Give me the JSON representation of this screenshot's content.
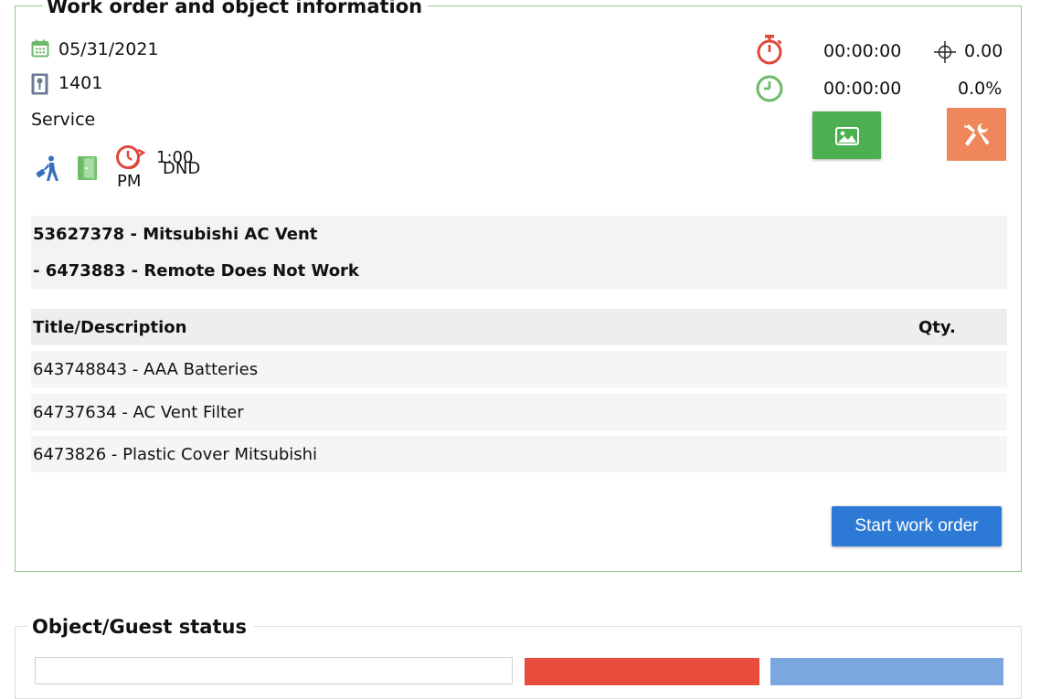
{
  "work_order": {
    "legend": "Work order and object information",
    "date": "05/31/2021",
    "room": "1401",
    "type": "Service",
    "dnd_time_line1": "1:00",
    "dnd_time_line2": "PM",
    "dnd_label": "DND",
    "timer_elapsed": "00:00:00",
    "timer_clock": "00:00:00",
    "distance": "0.00",
    "percent": "0.0%",
    "issue_line1": "53627378 - Mitsubishi AC Vent",
    "issue_line2": "- 6473883 - Remote Does Not Work",
    "table": {
      "headers": [
        "Title/Description",
        "Qty."
      ],
      "rows": [
        {
          "title": "643748843 - AAA Batteries",
          "qty": ""
        },
        {
          "title": "64737634 - AC Vent Filter",
          "qty": ""
        },
        {
          "title": "6473826 - Plastic Cover Mitsubishi",
          "qty": ""
        }
      ]
    },
    "start_button": "Start work order"
  },
  "object_status": {
    "legend": "Object/Guest status"
  },
  "colors": {
    "border_green": "#8cc985",
    "green_button": "#4caf50",
    "orange_button": "#f0875a",
    "blue_button": "#2d7ad6",
    "red_button": "#e74c3c",
    "light_blue_button": "#7aa7e0",
    "timer_red": "#e0483b",
    "clock_green": "#6dbb6a",
    "calendar_green": "#6dbb6a",
    "traveler_blue": "#3a6fbf",
    "door_green": "#6dbb6a"
  },
  "icons": [
    "calendar-icon",
    "room-key-icon",
    "guest-traveler-icon",
    "door-icon",
    "dnd-clock-icon",
    "stopwatch-icon",
    "clock-icon",
    "crosshair-icon",
    "image-icon",
    "tools-icon"
  ]
}
